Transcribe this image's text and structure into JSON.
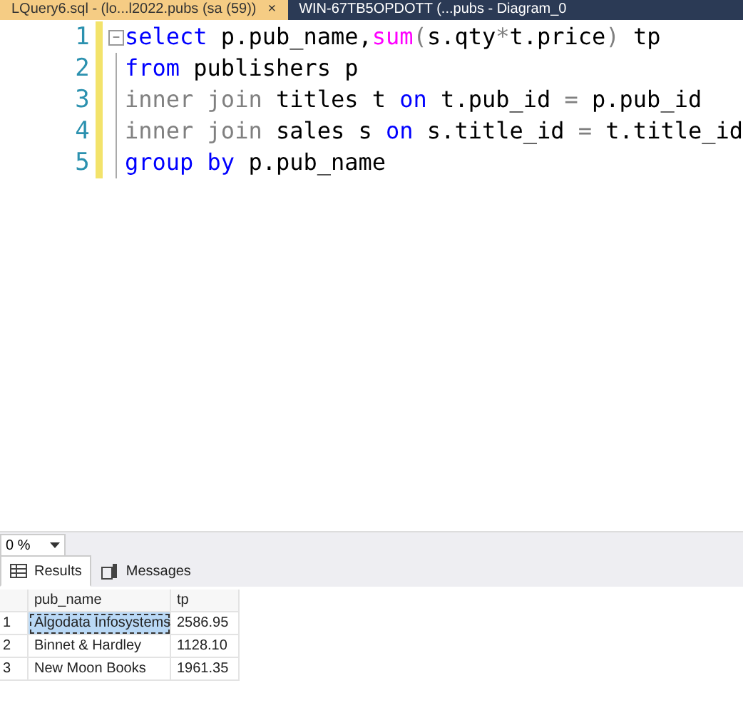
{
  "doc_tabs": [
    {
      "label": "LQuery6.sql - (lo...l2022.pubs (sa (59))",
      "selected": true,
      "close": "×"
    },
    {
      "label": "WIN-67TB5OPDOTT (...pubs - Diagram_0",
      "selected": false
    }
  ],
  "editor": {
    "lines": [
      {
        "number": "1",
        "collapse": "−",
        "tokens": [
          {
            "kind": "keyword",
            "text": "select"
          },
          {
            "kind": "plain",
            "text": " p.pub_name,"
          },
          {
            "kind": "function",
            "text": "sum"
          },
          {
            "kind": "operator",
            "text": "("
          },
          {
            "kind": "plain",
            "text": "s.qty"
          },
          {
            "kind": "operator",
            "text": "*"
          },
          {
            "kind": "plain",
            "text": "t.price"
          },
          {
            "kind": "operator",
            "text": ")"
          },
          {
            "kind": "plain",
            "text": " tp"
          }
        ]
      },
      {
        "number": "2",
        "tokens": [
          {
            "kind": "keyword",
            "text": "from"
          },
          {
            "kind": "plain",
            "text": " publishers p"
          }
        ]
      },
      {
        "number": "3",
        "tokens": [
          {
            "kind": "operator",
            "text": "inner join"
          },
          {
            "kind": "plain",
            "text": " titles t "
          },
          {
            "kind": "keyword",
            "text": "on"
          },
          {
            "kind": "plain",
            "text": " t.pub_id "
          },
          {
            "kind": "operator",
            "text": "="
          },
          {
            "kind": "plain",
            "text": " p.pub_id"
          }
        ]
      },
      {
        "number": "4",
        "tokens": [
          {
            "kind": "operator",
            "text": "inner join"
          },
          {
            "kind": "plain",
            "text": " sales s "
          },
          {
            "kind": "keyword",
            "text": "on"
          },
          {
            "kind": "plain",
            "text": " s.title_id "
          },
          {
            "kind": "operator",
            "text": "="
          },
          {
            "kind": "plain",
            "text": " t.title_id"
          }
        ]
      },
      {
        "number": "5",
        "tokens": [
          {
            "kind": "keyword",
            "text": "group by"
          },
          {
            "kind": "plain",
            "text": " p.pub_name"
          }
        ]
      }
    ]
  },
  "zoom": {
    "value": "0 %"
  },
  "result_tabs": [
    {
      "label": "Results",
      "selected": true
    },
    {
      "label": "Messages",
      "selected": false
    }
  ],
  "results": {
    "columns": [
      "pub_name",
      "tp"
    ],
    "rows": [
      {
        "number": "1",
        "cells": [
          "Algodata Infosystems",
          "2586.95"
        ],
        "selected": true
      },
      {
        "number": "2",
        "cells": [
          "Binnet & Hardley",
          "1128.10"
        ],
        "selected": false
      },
      {
        "number": "3",
        "cells": [
          "New Moon Books",
          "1961.35"
        ],
        "selected": false
      }
    ]
  }
}
